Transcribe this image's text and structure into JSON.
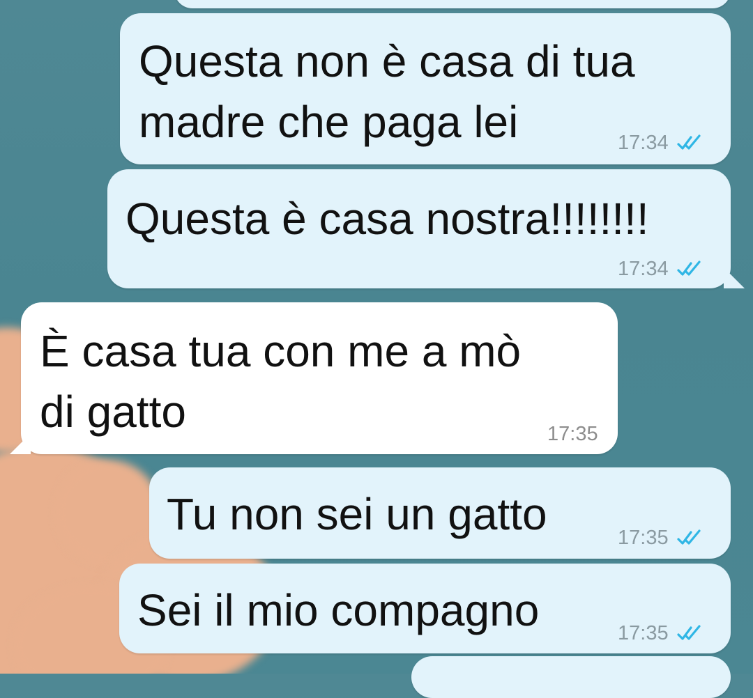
{
  "messages": [
    {
      "direction": "outgoing",
      "text_lines": [
        "Questa non è casa di tua",
        "madre che paga lei"
      ],
      "time": "17:34",
      "status_icon": "double-check-read-icon"
    },
    {
      "direction": "outgoing",
      "text_lines": [
        "Questa è casa nostra!!!!!!!!"
      ],
      "time": "17:34",
      "status_icon": "double-check-read-icon"
    },
    {
      "direction": "incoming",
      "text_lines": [
        "È casa tua con me a mò",
        "di gatto"
      ],
      "time": "17:35"
    },
    {
      "direction": "outgoing",
      "text_lines": [
        "Tu non sei un gatto"
      ],
      "time": "17:35",
      "status_icon": "double-check-read-icon"
    },
    {
      "direction": "outgoing",
      "text_lines": [
        "Sei il mio compagno"
      ],
      "time": "17:35",
      "status_icon": "double-check-read-icon"
    }
  ],
  "colors": {
    "outgoing_bubble": "#e2f3fb",
    "incoming_bubble": "#ffffff",
    "read_tick": "#2fb6e5",
    "background": "#4f8894"
  }
}
